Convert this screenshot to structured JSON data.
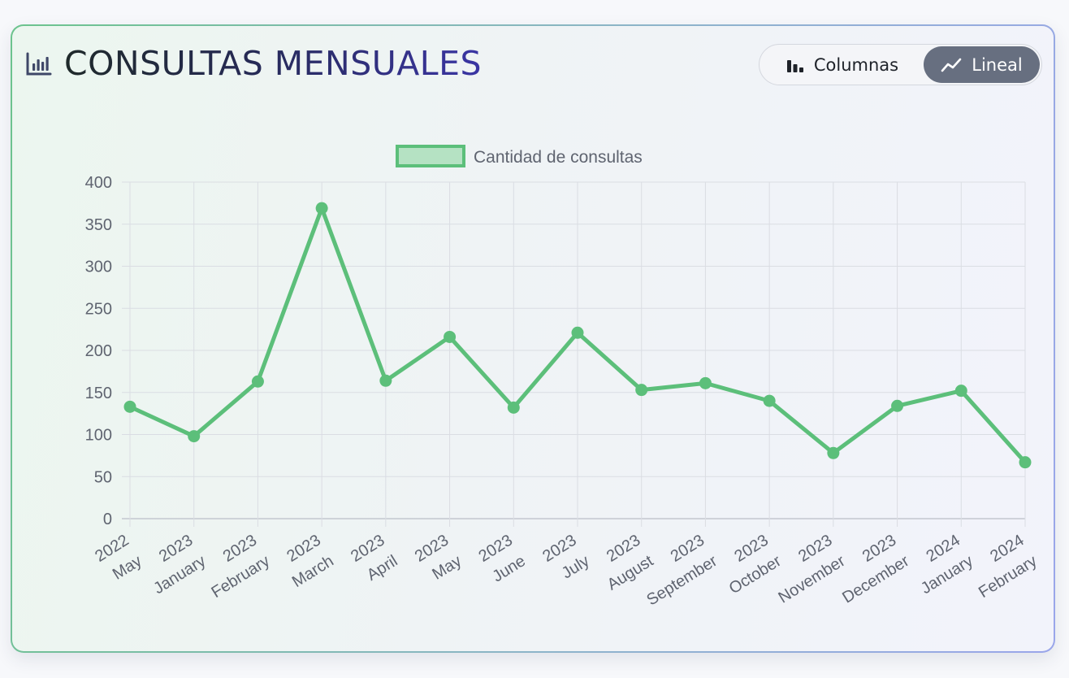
{
  "title": "CONSULTAS MENSUALES",
  "toggle": {
    "columns_label": "Columnas",
    "line_label": "Lineal",
    "active": "line"
  },
  "colors": {
    "series": "#5cbf7a",
    "series_fill": "#b5e2c3",
    "toggle_active_bg": "#676f80"
  },
  "chart_data": {
    "type": "line",
    "legend": {
      "position": "top-center",
      "entries": [
        "Cantidad de consultas"
      ]
    },
    "categories": [
      [
        "May",
        "2022"
      ],
      [
        "January",
        "2023"
      ],
      [
        "February",
        "2023"
      ],
      [
        "March",
        "2023"
      ],
      [
        "April",
        "2023"
      ],
      [
        "May",
        "2023"
      ],
      [
        "June",
        "2023"
      ],
      [
        "July",
        "2023"
      ],
      [
        "August",
        "2023"
      ],
      [
        "September",
        "2023"
      ],
      [
        "October",
        "2023"
      ],
      [
        "November",
        "2023"
      ],
      [
        "December",
        "2023"
      ],
      [
        "January",
        "2024"
      ],
      [
        "February",
        "2024"
      ]
    ],
    "series": [
      {
        "name": "Cantidad de consultas",
        "values": [
          133,
          98,
          163,
          369,
          164,
          216,
          132,
          221,
          153,
          161,
          140,
          78,
          134,
          152,
          67
        ]
      }
    ],
    "ylim": [
      0,
      400
    ],
    "yticks": [
      0,
      50,
      100,
      150,
      200,
      250,
      300,
      350,
      400
    ],
    "grid": true,
    "xlabel": "",
    "ylabel": ""
  }
}
